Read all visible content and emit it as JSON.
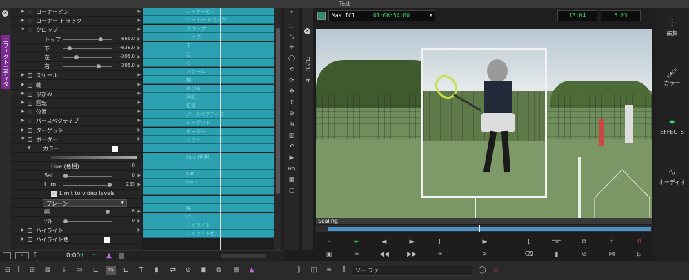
{
  "window": {
    "title": "Test"
  },
  "left_panel": {
    "tab_label": "エフェクトエディタ"
  },
  "params": [
    {
      "label": "コーナーピン",
      "type": "group",
      "level": 0,
      "expanded": false
    },
    {
      "label": "コーナー トラック",
      "type": "group",
      "level": 0,
      "expanded": false
    },
    {
      "label": "クロップ",
      "type": "group",
      "level": 0,
      "expanded": true
    },
    {
      "label": "トップ",
      "type": "slider",
      "value": "666.0",
      "pos": 0.8
    },
    {
      "label": "下",
      "type": "slider",
      "value": "-638.0",
      "pos": 0.1
    },
    {
      "label": "左",
      "type": "slider",
      "value": "-305.0",
      "pos": 0.25
    },
    {
      "label": "右",
      "type": "slider",
      "value": "305.0",
      "pos": 0.75
    },
    {
      "label": "スケール",
      "type": "group",
      "level": 0,
      "expanded": false
    },
    {
      "label": "軸",
      "type": "group",
      "level": 0,
      "expanded": false
    },
    {
      "label": "ゆがみ",
      "type": "group",
      "level": 0,
      "expanded": false
    },
    {
      "label": "回転",
      "type": "group",
      "level": 0,
      "expanded": false
    },
    {
      "label": "位置",
      "type": "group",
      "level": 0,
      "expanded": false
    },
    {
      "label": "パースペクティブ",
      "type": "group",
      "level": 0,
      "expanded": false
    },
    {
      "label": "ターゲット",
      "type": "group",
      "level": 0,
      "expanded": false
    },
    {
      "label": "ボーダー",
      "type": "group",
      "level": 0,
      "expanded": true
    },
    {
      "label": "カラー",
      "type": "color",
      "level": 1
    },
    {
      "label": "",
      "type": "bar"
    },
    {
      "label": "Hue (色相)",
      "type": "value",
      "value": "0"
    },
    {
      "label": "Sat",
      "type": "slider",
      "value": "0",
      "pos": 0.0
    },
    {
      "label": "Lum",
      "type": "slider",
      "value": "255",
      "pos": 1.0
    },
    {
      "label": "Limit to video levels",
      "type": "check"
    },
    {
      "label": "プレーン",
      "type": "dropdown"
    },
    {
      "label": "幅",
      "type": "slider",
      "value": "8",
      "pos": 0.95
    },
    {
      "label": "ｿﾌﾄ",
      "type": "slider",
      "value": "0",
      "pos": 0.0
    },
    {
      "label": "ハイライト",
      "type": "group",
      "level": 0,
      "expanded": false
    },
    {
      "label": "ハイライト色",
      "type": "color",
      "level": 0
    }
  ],
  "timeline_labels": [
    "コーナーピン",
    "コーナー トラック",
    "クロップ",
    "トップ",
    "下",
    "左",
    "右",
    "スケール",
    "軸",
    "ゆがみ",
    "回転",
    "位置",
    "パースペクティブ",
    "ターゲット",
    "ボーダー",
    "カラー",
    "",
    "Hue (色相)",
    "",
    "Sat",
    "Lum",
    "",
    "",
    "幅",
    "ｿﾌﾄ",
    "ハイライト",
    "ハイライト色"
  ],
  "status": {
    "timecode": "0:00"
  },
  "viewer": {
    "side_label": "コンポーザー",
    "source_name": "Mas TC1",
    "timecode": "01:06:54:00",
    "tc_a": "13:04",
    "tc_b": "6:03",
    "overlay_label": "Scaling"
  },
  "right_panel": {
    "items": [
      {
        "label": "編集",
        "icon": "edit-icon",
        "active": false
      },
      {
        "label": "カラー",
        "icon": "color-brush-icon",
        "active": false
      },
      {
        "label": "EFFECTS",
        "icon": "effects-wand-icon",
        "active": true
      },
      {
        "label": "オーディオ",
        "icon": "audio-wave-icon",
        "active": false
      }
    ]
  },
  "bottom": {
    "search_text": "ソー ファ"
  }
}
